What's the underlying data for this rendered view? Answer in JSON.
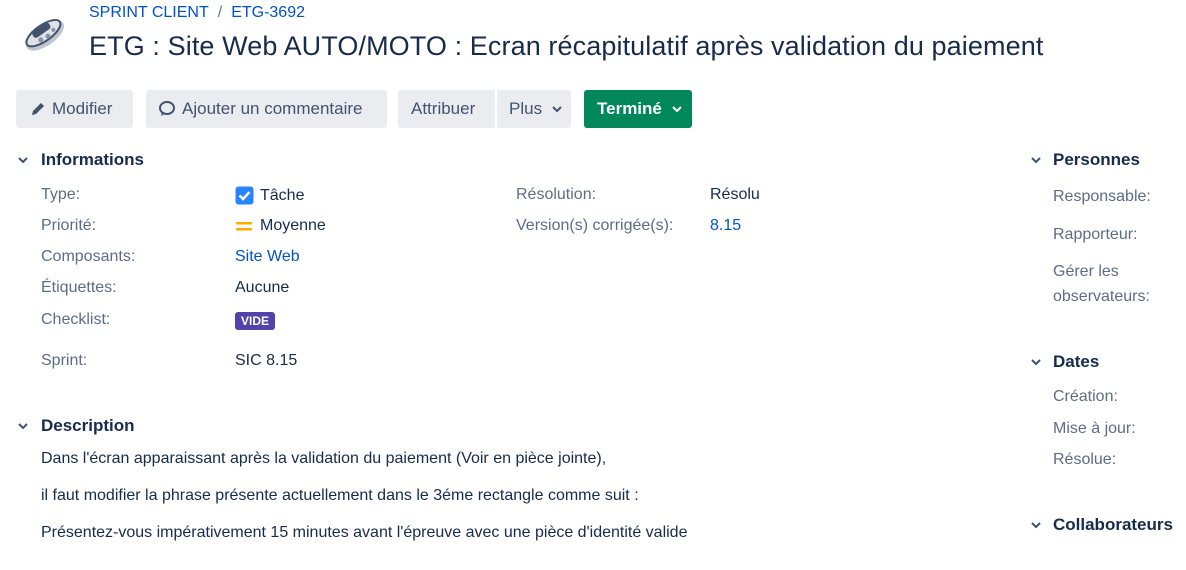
{
  "breadcrumb": {
    "project": "SPRINT CLIENT",
    "separator": "/",
    "issue_key": "ETG-3692"
  },
  "issue": {
    "title": "ETG : Site Web AUTO/MOTO : Ecran récapitulatif après validation du paiement"
  },
  "toolbar": {
    "edit_label": "Modifier",
    "comment_label": "Ajouter un commentaire",
    "assign_label": "Attribuer",
    "more_label": "Plus",
    "status_label": "Terminé"
  },
  "details": {
    "heading": "Informations",
    "type_label": "Type:",
    "type_value": "Tâche",
    "priority_label": "Priorité:",
    "priority_value": "Moyenne",
    "components_label": "Composants:",
    "components_value": "Site Web",
    "labels_label": "Étiquettes:",
    "labels_value": "Aucune",
    "checklist_label": "Checklist:",
    "checklist_value": "VIDE",
    "sprint_label": "Sprint:",
    "sprint_value": "SIC 8.15",
    "resolution_label": "Résolution:",
    "resolution_value": "Résolu",
    "fix_version_label": "Version(s) corrigée(s):",
    "fix_version_value": "8.15"
  },
  "description": {
    "heading": "Description",
    "paragraphs": [
      "Dans l'écran apparaissant après la validation du paiement (Voir en pièce jointe),",
      "il faut modifier la phrase présente actuellement dans le 3éme rectangle comme suit :",
      "Présentez-vous impérativement 15 minutes avant l'épreuve avec une pièce d'identité valide"
    ]
  },
  "people": {
    "heading": "Personnes",
    "assignee_label": "Responsable:",
    "reporter_label": "Rapporteur:",
    "watchers_label_line1": "Gérer les",
    "watchers_label_line2": "observateurs:"
  },
  "dates": {
    "heading": "Dates",
    "created_label": "Création:",
    "updated_label": "Mise à jour:",
    "resolved_label": "Résolue:"
  },
  "collaborators": {
    "heading": "Collaborateurs"
  },
  "colors": {
    "link": "#0052cc",
    "status_done": "#00875a",
    "lozenge": "#5243aa",
    "task_icon": "#2684ff",
    "priority_medium": "#ffab00"
  },
  "icons": {
    "edit": "pencil-icon",
    "comment": "comment-icon",
    "dropdown": "chevron-down-icon",
    "task": "task-checkbox-icon",
    "priority": "priority-medium-icon",
    "toggle": "section-toggle-icon",
    "project": "project-avatar-icon"
  }
}
